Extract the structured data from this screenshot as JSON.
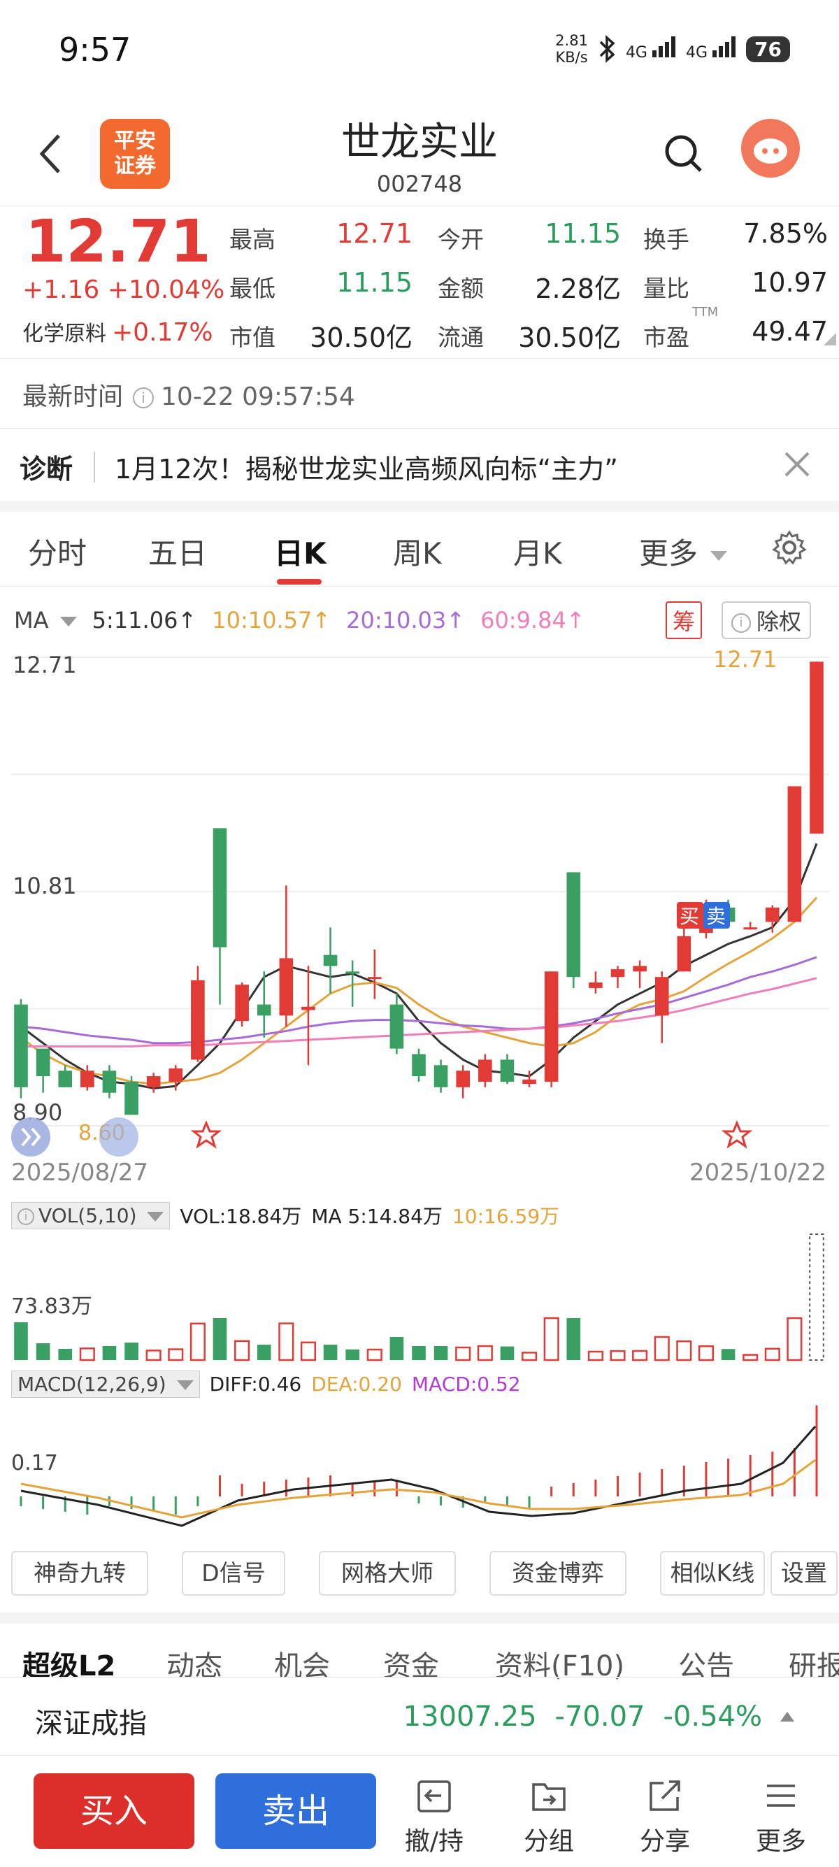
{
  "status": {
    "time": "9:57",
    "net_speed_value": "2.81",
    "net_speed_unit": "KB/s",
    "sim1": "4G",
    "sim2": "4G",
    "battery": "76"
  },
  "header": {
    "logo_line1": "平安",
    "logo_line2": "证券",
    "stock_name": "世龙实业",
    "stock_code": "002748"
  },
  "quote": {
    "price": "12.71",
    "change": "+1.16 +10.04%",
    "sector_name": "化学原料",
    "sector_change": "+0.17%",
    "fields": [
      {
        "label": "最高",
        "value": "12.71",
        "color": "#e23b36"
      },
      {
        "label": "今开",
        "value": "11.15",
        "color": "#2a9c5e"
      },
      {
        "label": "换手",
        "value": "7.85%",
        "color": "#222222"
      },
      {
        "label": "最低",
        "value": "11.15",
        "color": "#2a9c5e"
      },
      {
        "label": "金额",
        "value": "2.28亿",
        "color": "#222222"
      },
      {
        "label": "量比",
        "value": "10.97",
        "color": "#222222"
      },
      {
        "label": "市值",
        "value": "30.50亿",
        "color": "#222222"
      },
      {
        "label": "流通",
        "value": "30.50亿",
        "color": "#222222"
      },
      {
        "label": "市盈",
        "value": "49.47",
        "color": "#222222"
      }
    ],
    "pe_superscript": "TTM"
  },
  "updated": {
    "label": "最新时间",
    "value": "10-22 09:57:54"
  },
  "diagnosis": {
    "tag": "诊断",
    "text": "1月12次！揭秘世龙实业高频风向标“主力”"
  },
  "period_tabs": [
    {
      "label": "分时"
    },
    {
      "label": "五日"
    },
    {
      "label": "日K"
    },
    {
      "label": "周K"
    },
    {
      "label": "月K"
    },
    {
      "label": "更多"
    }
  ],
  "ma_legend": {
    "label": "MA",
    "ma5": "5:11.06↑",
    "ma10": "10:10.57↑",
    "ma20": "20:10.03↑",
    "ma60": "60:9.84↑",
    "chip_chou": "筹",
    "chip_fuquan": "除权",
    "colors": {
      "ma5": "#333333",
      "ma10": "#e5a33b",
      "ma20": "#a56bd6",
      "ma60": "#ee7fb8"
    }
  },
  "kline": {
    "price_high_label": "12.71",
    "price_mid_label": "10.81",
    "price_low_label": "8.90",
    "low_marker": "8.60",
    "high_marker": "12.71",
    "start_date": "2025/08/27",
    "end_date": "2025/10/22",
    "buy_tag": "买",
    "sell_tag": "卖"
  },
  "chart_data": {
    "type": "candlestick",
    "x_range": [
      "2025/08/27",
      "2025/10/22"
    ],
    "y_range": [
      8.6,
      12.71
    ],
    "candles": [
      {
        "o": 9.6,
        "h": 9.65,
        "l": 8.75,
        "c": 8.85
      },
      {
        "o": 9.2,
        "h": 9.2,
        "l": 8.8,
        "c": 8.95
      },
      {
        "o": 9.0,
        "h": 9.05,
        "l": 8.85,
        "c": 8.85
      },
      {
        "o": 8.85,
        "h": 9.05,
        "l": 8.82,
        "c": 9.0
      },
      {
        "o": 9.0,
        "h": 9.05,
        "l": 8.75,
        "c": 8.8
      },
      {
        "o": 8.9,
        "h": 8.95,
        "l": 8.6,
        "c": 8.6
      },
      {
        "o": 8.85,
        "h": 8.98,
        "l": 8.8,
        "c": 8.95
      },
      {
        "o": 8.9,
        "h": 9.05,
        "l": 8.82,
        "c": 9.02
      },
      {
        "o": 9.1,
        "h": 9.95,
        "l": 9.08,
        "c": 9.82
      },
      {
        "o": 11.2,
        "h": 11.2,
        "l": 9.6,
        "c": 10.12
      },
      {
        "o": 9.45,
        "h": 9.8,
        "l": 9.4,
        "c": 9.78
      },
      {
        "o": 9.6,
        "h": 9.9,
        "l": 9.3,
        "c": 9.5
      },
      {
        "o": 9.5,
        "h": 10.68,
        "l": 9.4,
        "c": 10.02
      },
      {
        "o": 9.55,
        "h": 9.95,
        "l": 9.05,
        "c": 9.58
      },
      {
        "o": 10.05,
        "h": 10.3,
        "l": 9.7,
        "c": 9.95
      },
      {
        "o": 9.9,
        "h": 10.0,
        "l": 9.58,
        "c": 9.88
      },
      {
        "o": 9.85,
        "h": 10.1,
        "l": 9.65,
        "c": 9.85
      },
      {
        "o": 9.6,
        "h": 9.7,
        "l": 9.15,
        "c": 9.2
      },
      {
        "o": 9.15,
        "h": 9.2,
        "l": 8.9,
        "c": 8.95
      },
      {
        "o": 9.05,
        "h": 9.1,
        "l": 8.8,
        "c": 8.85
      },
      {
        "o": 8.85,
        "h": 9.05,
        "l": 8.75,
        "c": 9.0
      },
      {
        "o": 8.9,
        "h": 9.15,
        "l": 8.85,
        "c": 9.1
      },
      {
        "o": 9.1,
        "h": 9.15,
        "l": 8.88,
        "c": 8.9
      },
      {
        "o": 8.88,
        "h": 9.0,
        "l": 8.85,
        "c": 8.92
      },
      {
        "o": 8.9,
        "h": 9.9,
        "l": 8.85,
        "c": 9.9
      },
      {
        "o": 10.8,
        "h": 10.8,
        "l": 9.75,
        "c": 9.85
      },
      {
        "o": 9.75,
        "h": 9.9,
        "l": 9.7,
        "c": 9.8
      },
      {
        "o": 9.85,
        "h": 9.95,
        "l": 9.75,
        "c": 9.92
      },
      {
        "o": 9.9,
        "h": 10.0,
        "l": 9.75,
        "c": 9.95
      },
      {
        "o": 9.5,
        "h": 9.9,
        "l": 9.25,
        "c": 9.85
      },
      {
        "o": 9.9,
        "h": 10.3,
        "l": 9.9,
        "c": 10.22
      },
      {
        "o": 10.25,
        "h": 10.55,
        "l": 10.2,
        "c": 10.42
      },
      {
        "o": 10.48,
        "h": 10.55,
        "l": 10.32,
        "c": 10.35
      },
      {
        "o": 10.3,
        "h": 10.35,
        "l": 10.28,
        "c": 10.3
      },
      {
        "o": 10.35,
        "h": 10.5,
        "l": 10.25,
        "c": 10.48
      },
      {
        "o": 10.35,
        "h": 11.58,
        "l": 10.35,
        "c": 11.58
      },
      {
        "o": 11.15,
        "h": 12.71,
        "l": 11.15,
        "c": 12.71
      }
    ],
    "ma_series": [
      {
        "name": "MA5",
        "values": [
          9.4,
          9.25,
          9.1,
          8.98,
          8.9,
          8.88,
          8.84,
          8.86,
          9.05,
          9.25,
          9.55,
          9.85,
          9.95,
          9.9,
          9.85,
          9.88,
          9.8,
          9.7,
          9.45,
          9.25,
          9.1,
          9.0,
          8.98,
          8.95,
          9.1,
          9.3,
          9.45,
          9.6,
          9.7,
          9.8,
          9.95,
          10.05,
          10.15,
          10.22,
          10.3,
          10.55,
          11.06
        ]
      },
      {
        "name": "MA10",
        "values": [
          9.3,
          9.15,
          9.05,
          8.98,
          8.95,
          8.9,
          8.88,
          8.9,
          8.92,
          8.98,
          9.1,
          9.25,
          9.4,
          9.55,
          9.7,
          9.78,
          9.8,
          9.75,
          9.6,
          9.48,
          9.4,
          9.35,
          9.3,
          9.25,
          9.22,
          9.25,
          9.35,
          9.5,
          9.6,
          9.65,
          9.72,
          9.85,
          9.97,
          10.08,
          10.2,
          10.35,
          10.57
        ]
      },
      {
        "name": "MA20",
        "values": [
          9.4,
          9.38,
          9.35,
          9.32,
          9.3,
          9.28,
          9.25,
          9.25,
          9.26,
          9.28,
          9.3,
          9.33,
          9.36,
          9.4,
          9.43,
          9.45,
          9.46,
          9.46,
          9.45,
          9.43,
          9.41,
          9.4,
          9.38,
          9.38,
          9.4,
          9.43,
          9.47,
          9.52,
          9.56,
          9.6,
          9.66,
          9.72,
          9.78,
          9.85,
          9.9,
          9.96,
          10.03
        ]
      },
      {
        "name": "MA60",
        "values": [
          9.22,
          9.22,
          9.22,
          9.22,
          9.22,
          9.22,
          9.23,
          9.23,
          9.23,
          9.24,
          9.25,
          9.26,
          9.27,
          9.28,
          9.29,
          9.3,
          9.31,
          9.32,
          9.33,
          9.34,
          9.35,
          9.36,
          9.37,
          9.38,
          9.39,
          9.41,
          9.43,
          9.45,
          9.48,
          9.51,
          9.55,
          9.6,
          9.65,
          9.7,
          9.74,
          9.79,
          9.84
        ]
      }
    ],
    "volume": {
      "label": "VOL(5,10)",
      "vol": "VOL:18.84万",
      "ma5": "MA 5:14.84万",
      "ma10": "10:16.59万",
      "y_label": "73.83万"
    },
    "macd": {
      "label": "MACD(12,26,9)",
      "diff": "DIFF:0.46",
      "dea": "DEA:0.20",
      "macd": "MACD:0.52",
      "y_label": "0.17"
    }
  },
  "tools": [
    "神奇九转",
    "D信号",
    "网格大师",
    "资金博弈",
    "相似K线",
    "设置"
  ],
  "sub_tabs": [
    "超级L2",
    "动态",
    "机会",
    "资金",
    "资料(F10)",
    "公告",
    "研报"
  ],
  "index": {
    "name": "深证成指",
    "value": "13007.25",
    "change": "-70.07",
    "pct": "-0.54%"
  },
  "bottom_bar": {
    "buy": "买入",
    "sell": "卖出",
    "cancel": "撤/持",
    "group": "分组",
    "share": "分享",
    "more": "更多"
  }
}
